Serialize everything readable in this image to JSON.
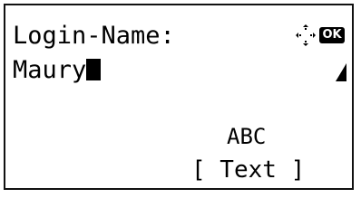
{
  "screen": {
    "field_label": "Login-Name:",
    "field_value": "Maury",
    "ok_label": "OK",
    "input_mode": "ABC",
    "soft_key_label": "[ Text ]"
  },
  "icons": {
    "navigation": "four-way-navigation-icon",
    "ok": "ok-button-icon",
    "corner": "triangle-corner-icon"
  },
  "colors": {
    "foreground": "#000000",
    "background": "#ffffff"
  }
}
